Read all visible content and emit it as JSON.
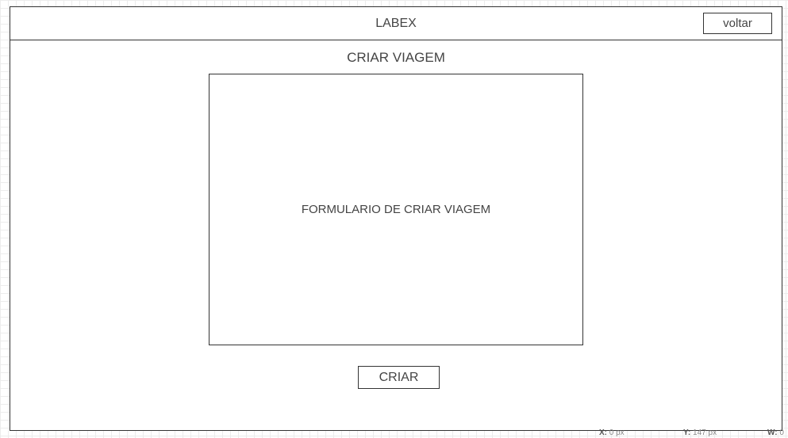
{
  "header": {
    "title": "LABEX",
    "back_label": "voltar"
  },
  "main": {
    "title": "CRIAR VIAGEM",
    "form_placeholder": "FORMULARIO DE CRIAR VIAGEM",
    "create_label": "CRIAR"
  },
  "status_bar": {
    "x_label": "X:",
    "x_value": "0 px",
    "y_label": "Y:",
    "y_value": "147 px",
    "w_label": "W:",
    "w_value": "0"
  }
}
